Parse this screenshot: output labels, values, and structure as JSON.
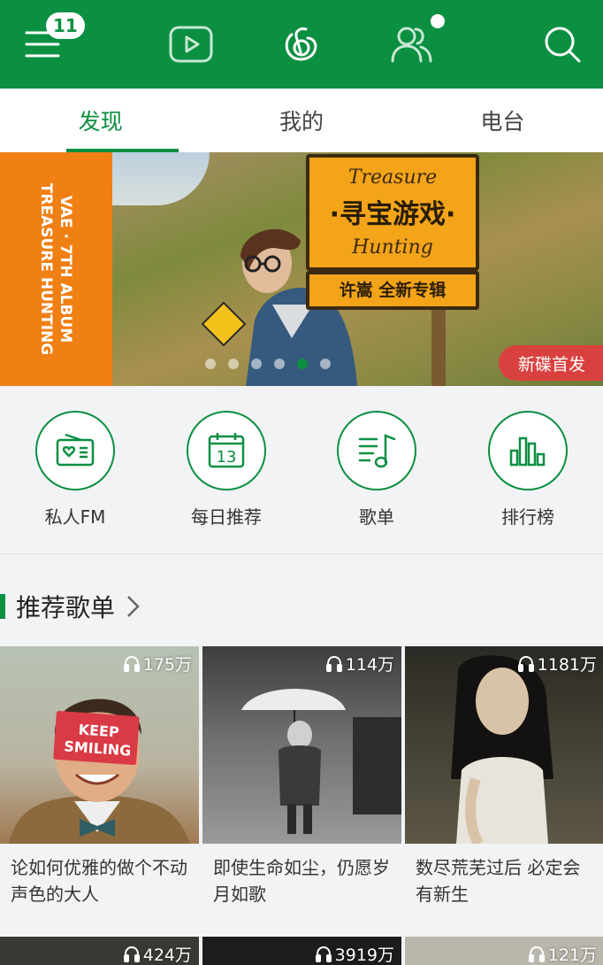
{
  "topbar": {
    "badge_count": "11",
    "icons": [
      "menu-icon",
      "video-icon",
      "music-logo-icon",
      "friends-icon",
      "search-icon"
    ]
  },
  "tabs": [
    {
      "label": "发现",
      "active": true
    },
    {
      "label": "我的",
      "active": false
    },
    {
      "label": "电台",
      "active": false
    }
  ],
  "banner": {
    "side_text_line1": "VAE · 7TH ALBUM",
    "side_text_line2": "TREASURE HUNTING",
    "sign_top": "Treasure",
    "sign_cn": "·寻宝游戏·",
    "sign_bottom": "Hunting",
    "sign_strip": "许嵩 全新专辑",
    "tag": "新碟首发",
    "pager_total": 6,
    "pager_active": 4
  },
  "quick": [
    {
      "label": "私人FM",
      "icon": "radio-icon"
    },
    {
      "label": "每日推荐",
      "icon": "calendar-icon",
      "day": "13"
    },
    {
      "label": "歌单",
      "icon": "playlist-icon"
    },
    {
      "label": "排行榜",
      "icon": "chart-bars-icon"
    }
  ],
  "section": {
    "title": "推荐歌单"
  },
  "playlists": [
    {
      "plays": "175万",
      "title": "论如何优雅的做个不动声色的大人",
      "cover_text": "KEEP SMILING"
    },
    {
      "plays": "114万",
      "title": "即使生命如尘，仍愿岁月如歌"
    },
    {
      "plays": "1181万",
      "title": "数尽荒芜过后 必定会有新生"
    }
  ],
  "playlists_row2": [
    {
      "plays": "424万"
    },
    {
      "plays": "3919万"
    },
    {
      "plays": "121万"
    }
  ],
  "colors": {
    "brand_green": "#0b8f41",
    "tag_red": "#d9413f",
    "banner_orange": "#f07f14"
  }
}
